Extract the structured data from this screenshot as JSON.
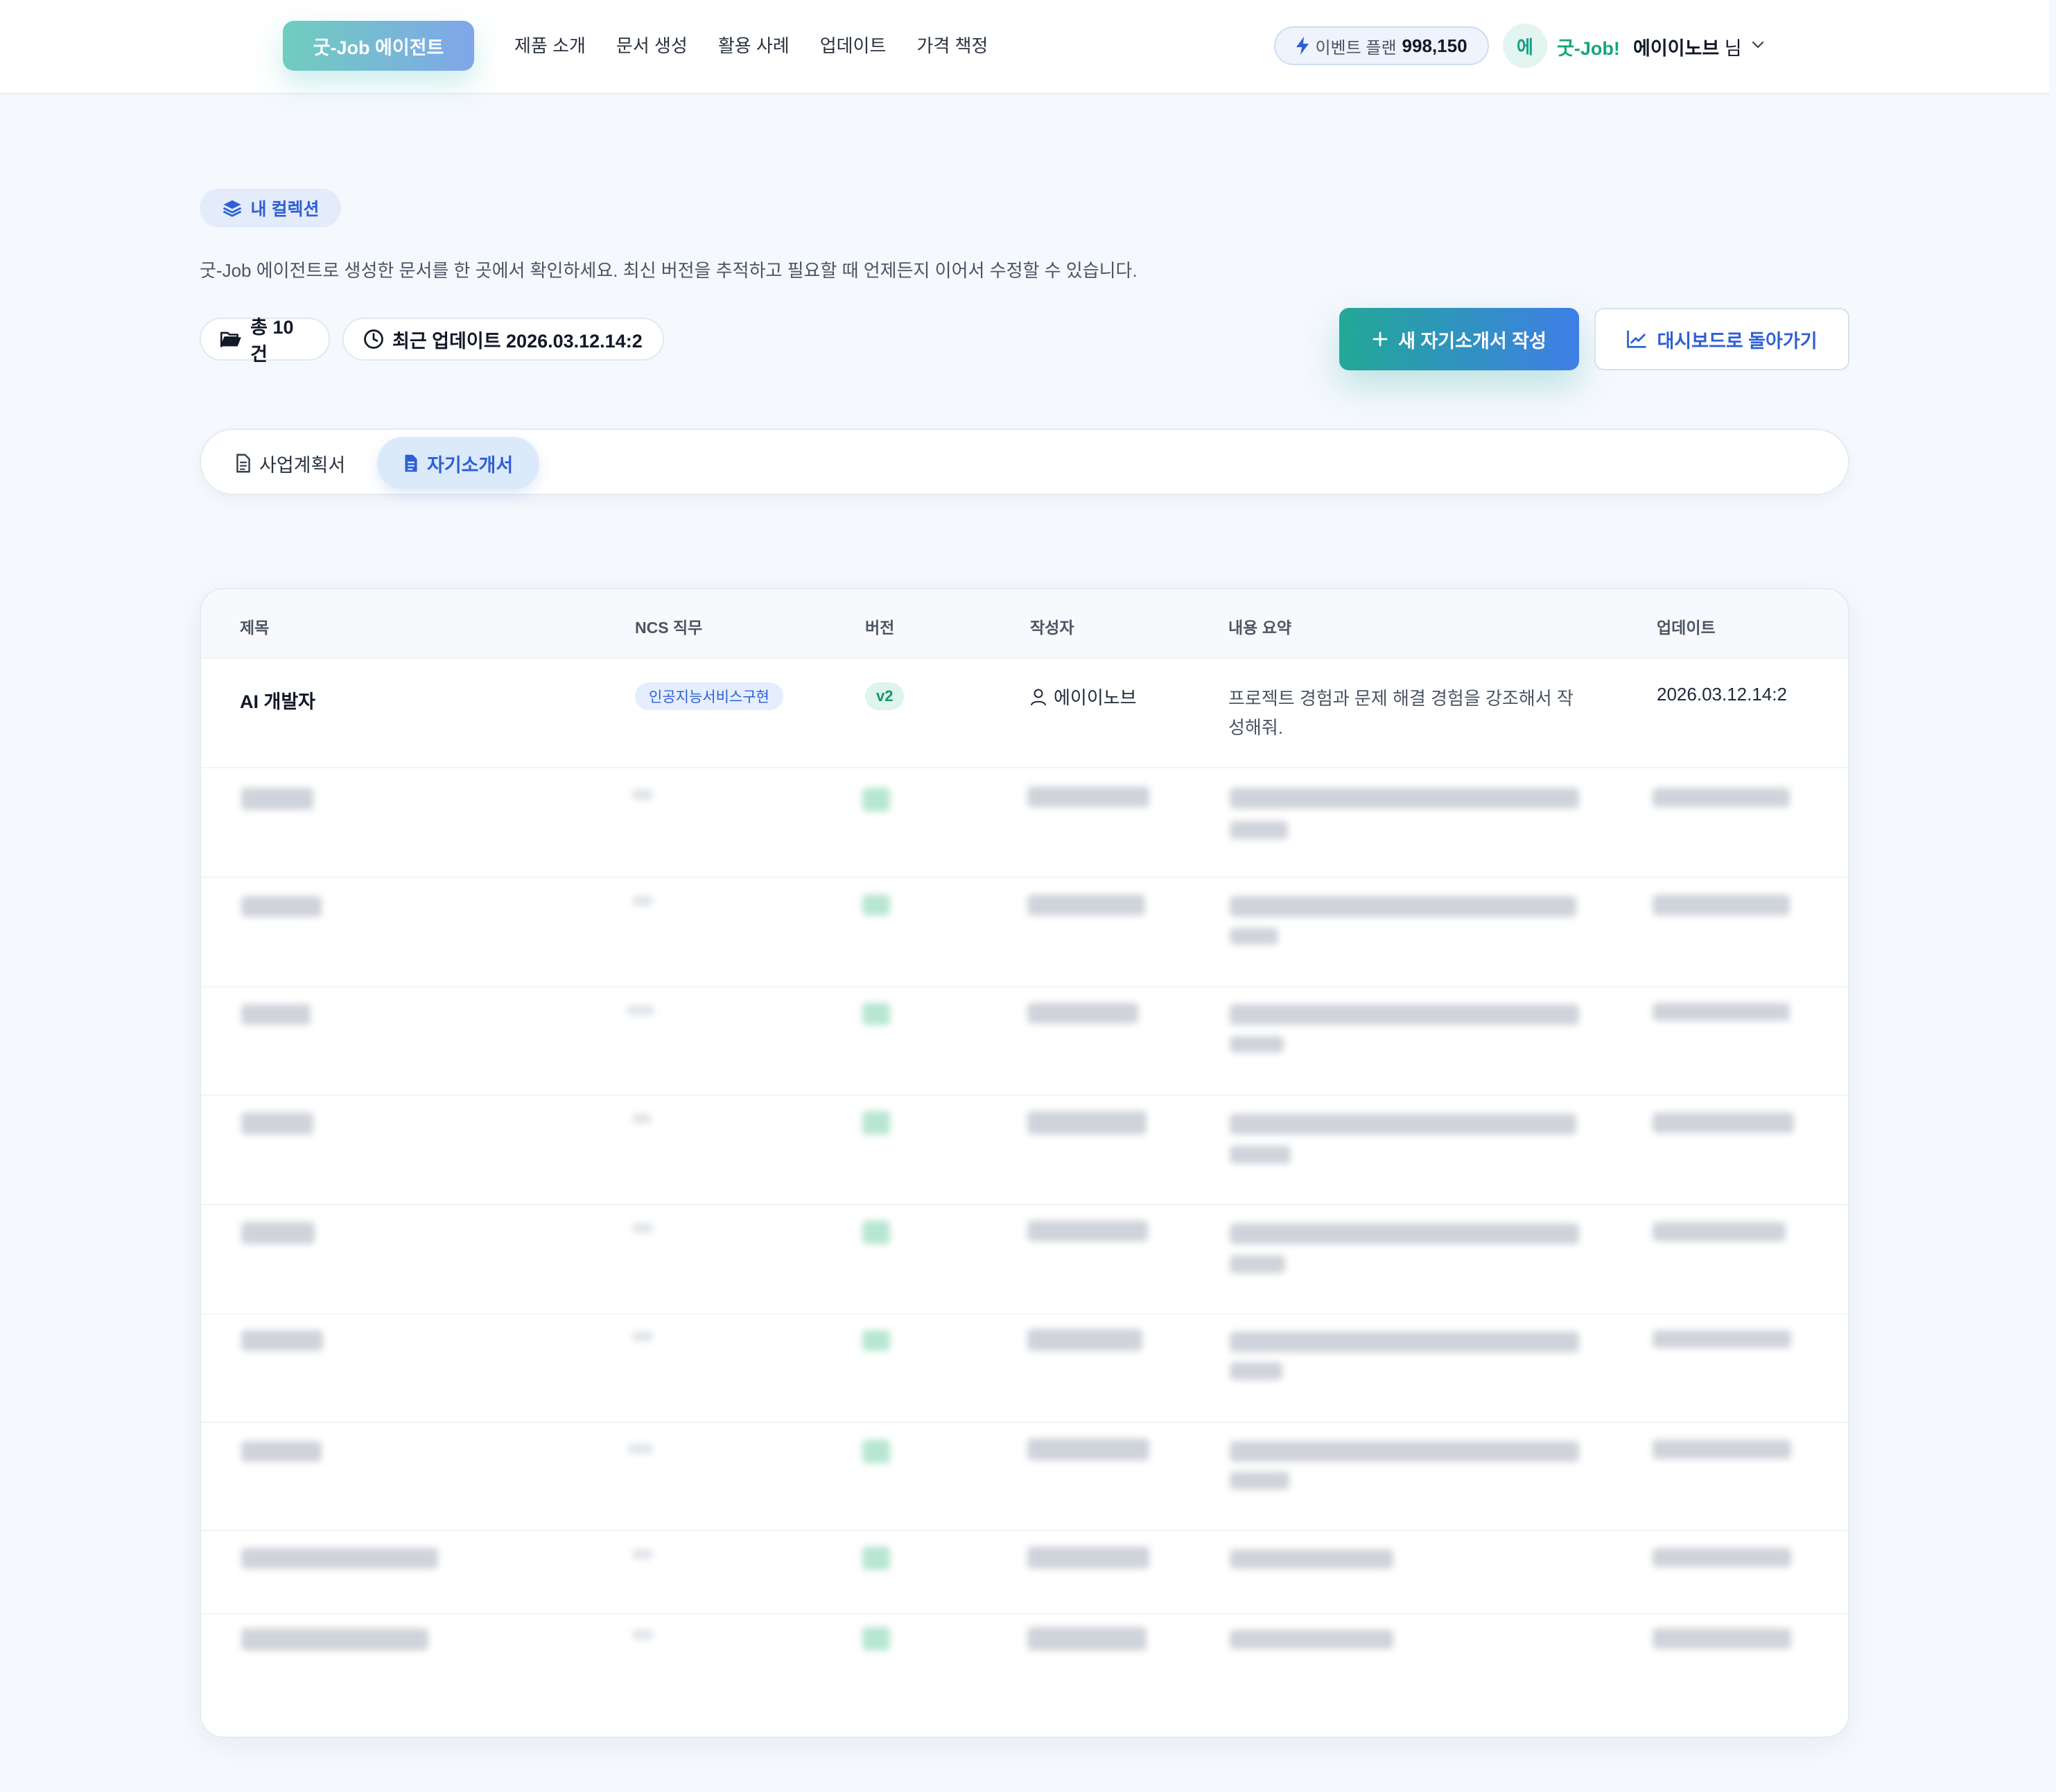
{
  "header": {
    "logo": "굿-Job 에이전트",
    "nav": [
      "제품 소개",
      "문서 생성",
      "활용 사례",
      "업데이트",
      "가격 책정"
    ],
    "event_label": "이벤트 플랜",
    "event_value": "998,150",
    "avatar_initial": "에",
    "brand": "굿-Job!",
    "user_name": "에이이노브",
    "user_suffix": "님"
  },
  "collection": {
    "badge": "내 컬렉션",
    "description": "굿-Job 에이전트로 생성한 문서를 한 곳에서 확인하세요. 최신 버전을 추적하고 필요할 때 언제든지 이어서 수정할 수 있습니다.",
    "total": "총 10건",
    "last_update": "최근 업데이트 2026.03.12.14:2",
    "new_button": "새 자기소개서 작성",
    "dashboard_button": "대시보드로 돌아가기"
  },
  "tabs": [
    {
      "label": "사업계획서",
      "active": false
    },
    {
      "label": "자기소개서",
      "active": true
    }
  ],
  "table": {
    "columns": [
      "제목",
      "NCS 직무",
      "버전",
      "작성자",
      "내용 요약",
      "업데이트"
    ],
    "rows": [
      {
        "title": "AI 개발자",
        "ncs": "인공지능서비스구현",
        "version": "v2",
        "author": "에이이노브",
        "summary": "프로젝트 경험과 문제 해결 경험을 강조해서 작성해줘.",
        "updated": "2026.03.12.14:2"
      }
    ]
  },
  "colors": {
    "accent_teal": "#22a897",
    "accent_blue": "#2f5fd3",
    "background": "#f5f8fd"
  },
  "icons": [
    "bolt-icon",
    "chevron-down-icon",
    "layers-icon",
    "folder-open-icon",
    "clock-icon",
    "plus-icon",
    "chart-line-icon",
    "document-icon",
    "user-icon"
  ]
}
